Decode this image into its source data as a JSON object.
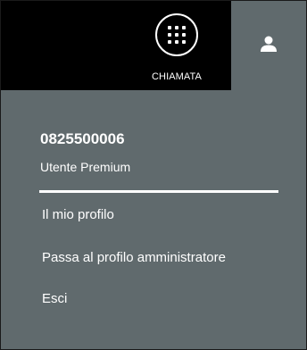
{
  "topbar": {
    "call_button": {
      "label": "CHIAMATA",
      "icon": "grid-dots-icon"
    },
    "user_button": {
      "icon": "user-icon"
    }
  },
  "user_menu": {
    "phone_number": "0825500006",
    "user_type": "Utente Premium",
    "items": [
      {
        "label": "Il mio profilo"
      },
      {
        "label": "Passa al profilo amministratore"
      },
      {
        "label": "Esci"
      }
    ]
  },
  "colors": {
    "topbar_bg": "#000000",
    "panel_bg": "#606a6d",
    "text": "#ffffff"
  }
}
